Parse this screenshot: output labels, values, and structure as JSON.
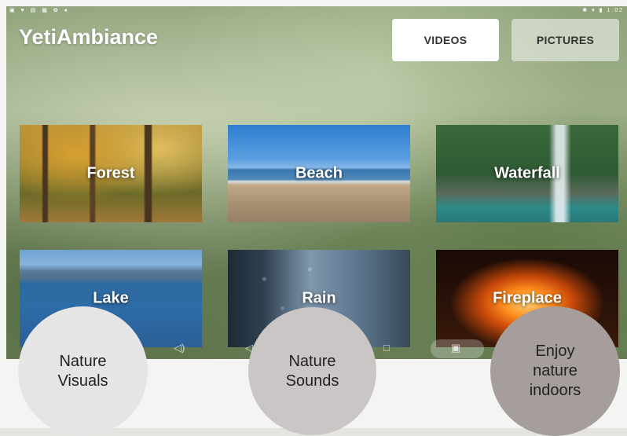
{
  "app": {
    "title": "YetiAmbiance"
  },
  "status_bar": {
    "time": "1:02"
  },
  "tabs": [
    {
      "label": "VIDEOS",
      "selected": true
    },
    {
      "label": "PICTURES",
      "selected": false
    }
  ],
  "tiles": [
    {
      "label": "Forest"
    },
    {
      "label": "Beach"
    },
    {
      "label": "Waterfall"
    },
    {
      "label": "Lake"
    },
    {
      "label": "Rain"
    },
    {
      "label": "Fireplace"
    }
  ],
  "nav_bar": {
    "icons": [
      "volume-icon",
      "back-icon",
      "home-icon",
      "screenshot-icon"
    ]
  },
  "features": [
    {
      "label_line1": "Nature",
      "label_line2": "Visuals"
    },
    {
      "label_line1": "Nature",
      "label_line2": "Sounds"
    },
    {
      "label_line1": "Enjoy",
      "label_line2": "nature",
      "label_line3": "indoors"
    }
  ],
  "colors": {
    "selected_tab": "#ffffff",
    "unselected_tab": "#e1e4dc",
    "bubble_1": "#e6e5e5",
    "bubble_2": "#cbc6c6",
    "bubble_3": "#a69d9d"
  }
}
